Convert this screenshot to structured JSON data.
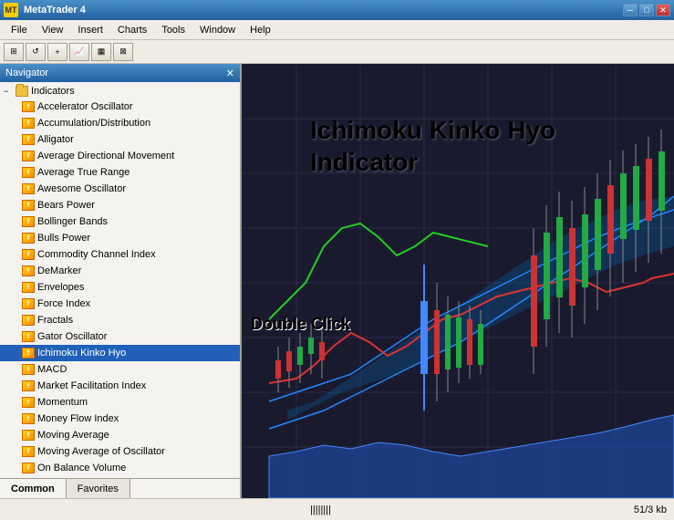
{
  "titlebar": {
    "title": "MetaTrader 4",
    "app_icon": "MT",
    "controls": {
      "minimize": "─",
      "maximize": "□",
      "close": "✕"
    }
  },
  "menubar": {
    "items": [
      "File",
      "View",
      "Insert",
      "Charts",
      "Tools",
      "Window",
      "Help"
    ]
  },
  "navigator": {
    "title": "Navigator",
    "close_icon": "✕",
    "collapse_icon": "−",
    "root_label": "Indicators",
    "items": [
      "Accelerator Oscillator",
      "Accumulation/Distribution",
      "Alligator",
      "Average Directional Movement",
      "Average True Range",
      "Awesome Oscillator",
      "Bears Power",
      "Bollinger Bands",
      "Bulls Power",
      "Commodity Channel Index",
      "DeMarker",
      "Envelopes",
      "Force Index",
      "Fractals",
      "Gator Oscillator",
      "Ichimoku Kinko Hyo",
      "MACD",
      "Market Facilitation Index",
      "Momentum",
      "Money Flow Index",
      "Moving Average",
      "Moving Average of Oscillator",
      "On Balance Volume"
    ],
    "selected_index": 15,
    "tabs": [
      "Common",
      "Favorites"
    ]
  },
  "chart": {
    "double_click_label": "Double Click",
    "indicator_label_line1": "Ichimoku Kinko Hyo",
    "indicator_label_line2": "Indicator"
  },
  "statusbar": {
    "bars_indicator": "||||||||",
    "info": "51/3 kb"
  }
}
